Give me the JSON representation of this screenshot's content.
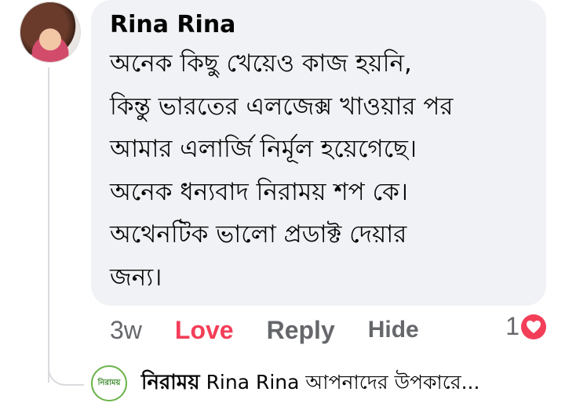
{
  "comment": {
    "author": "Rina Rina",
    "text": "অনেক কিছু খেয়েও কাজ হয়নি,\nকিন্তু ভারতের এলজেক্স খাওয়ার পর\nআমার এলার্জি নির্মূল হয়েগেছে।\nঅনেক ধন্যবাদ নিরাময় শপ কে।\nঅথেনটিক ভালো প্রডাক্ট দেয়ার\nজন্য।",
    "time": "3w",
    "love_label": "Love",
    "reply_label": "Reply",
    "hide_label": "Hide",
    "reaction_count": "1",
    "reaction_icon": "heart-icon"
  },
  "reply_preview": {
    "logo_text": "নিরাময়",
    "author": "নিরাময়",
    "text": "Rina Rina আপনাদের উপকারে..."
  },
  "colors": {
    "bubble": "#f0f2f5",
    "love": "#f33e58",
    "muted": "#65676b"
  }
}
